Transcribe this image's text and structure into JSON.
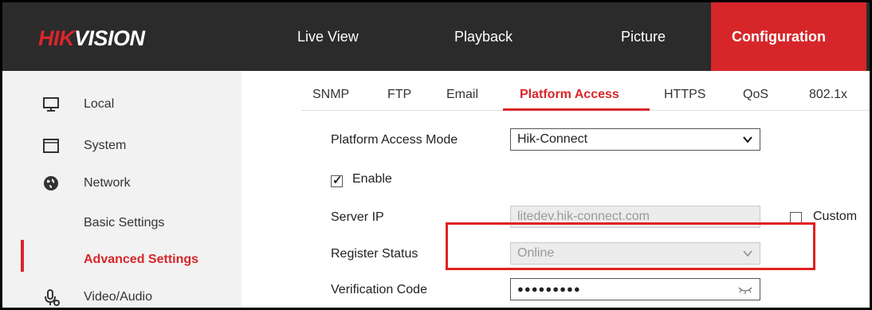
{
  "brand": {
    "hik": "HIK",
    "vision": "VISION"
  },
  "nav": {
    "live_view": "Live View",
    "playback": "Playback",
    "picture": "Picture",
    "configuration": "Configuration"
  },
  "sidebar": {
    "local": "Local",
    "system": "System",
    "network": "Network",
    "basic_settings": "Basic Settings",
    "advanced_settings": "Advanced Settings",
    "video_audio": "Video/Audio"
  },
  "tabs": {
    "snmp": "SNMP",
    "ftp": "FTP",
    "email": "Email",
    "platform_access": "Platform Access",
    "https": "HTTPS",
    "qos": "QoS",
    "dot1x": "802.1x"
  },
  "form": {
    "mode_label": "Platform Access Mode",
    "mode_value": "Hik-Connect",
    "enable_label": "Enable",
    "enable_checked": true,
    "server_ip_label": "Server IP",
    "server_ip_value": "litedev.hik-connect.com",
    "custom_label": "Custom",
    "custom_checked": false,
    "register_status_label": "Register Status",
    "register_status_value": "Online",
    "verification_label": "Verification Code",
    "verification_value": "●●●●●●●●●"
  },
  "colors": {
    "accent": "#d7262a",
    "highlight": "#e02020",
    "topbar": "#2b2b2b",
    "sidebar": "#f2f2f2"
  }
}
